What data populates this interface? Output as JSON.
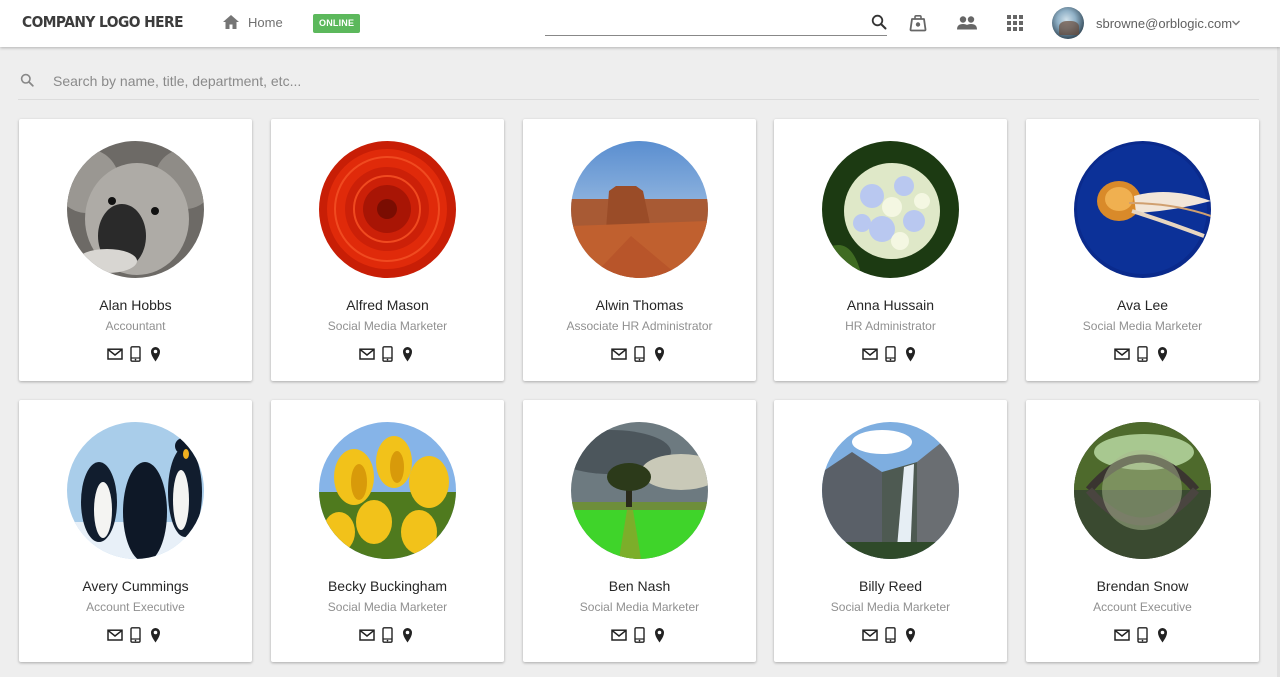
{
  "header": {
    "logo_text": "COMPANY LOGO HERE",
    "home_label": "Home",
    "status_badge": "ONLINE",
    "status_color": "#5cb85c",
    "search_value": "",
    "icons": [
      "search-icon",
      "briefcase-icon",
      "people-icon",
      "apps-grid-icon"
    ],
    "user_email": "sbrowne@orblogic.com"
  },
  "directory_search": {
    "placeholder": "Search by name, title, department, etc..."
  },
  "people": [
    {
      "name": "Alan Hobbs",
      "title": "Accountant",
      "photo": "koala"
    },
    {
      "name": "Alfred Mason",
      "title": "Social Media Marketer",
      "photo": "red-flower"
    },
    {
      "name": "Alwin Thomas",
      "title": "Associate HR Administrator",
      "photo": "desert-butte"
    },
    {
      "name": "Anna Hussain",
      "title": "HR Administrator",
      "photo": "hydrangea"
    },
    {
      "name": "Ava Lee",
      "title": "Social Media Marketer",
      "photo": "jellyfish"
    },
    {
      "name": "Avery Cummings",
      "title": "Account Executive",
      "photo": "penguins"
    },
    {
      "name": "Becky Buckingham",
      "title": "Social Media Marketer",
      "photo": "tulips"
    },
    {
      "name": "Ben Nash",
      "title": "Social Media Marketer",
      "photo": "tree-field"
    },
    {
      "name": "Billy Reed",
      "title": "Social Media Marketer",
      "photo": "waterfall"
    },
    {
      "name": "Brendan Snow",
      "title": "Account Executive",
      "photo": "bridge-reflection"
    }
  ],
  "card_actions": [
    "email-icon",
    "mobile-phone-icon",
    "location-pin-icon"
  ]
}
